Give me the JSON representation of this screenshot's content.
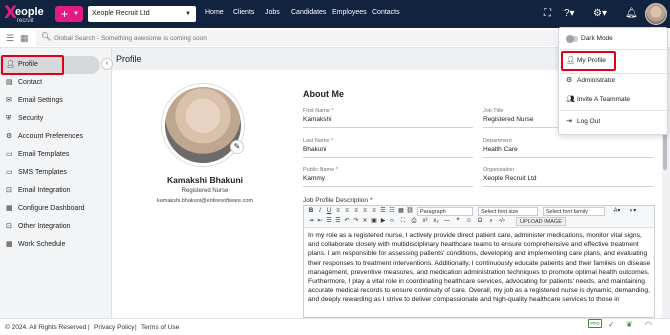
{
  "header": {
    "logo_main": "eople",
    "logo_sub": "recruit",
    "logo_x": "X",
    "company": "Xeople Recruit Ltd",
    "nav": [
      "Home",
      "Clients",
      "Jobs",
      "Candidates",
      "Employees",
      "Contacts"
    ],
    "icons": [
      "fullscreen-icon",
      "help-icon",
      "gear-icon",
      "bell-icon"
    ],
    "colors": {
      "navbar": "#12233f",
      "accent": "#e31b84"
    }
  },
  "search": {
    "placeholder": "Global Search - Something awesome is coming soon"
  },
  "sidebar": {
    "items": [
      {
        "label": "Profile",
        "icon": "user-icon"
      },
      {
        "label": "Contact",
        "icon": "address-card-icon"
      },
      {
        "label": "Email Settings",
        "icon": "mail-icon"
      },
      {
        "label": "Security",
        "icon": "shield-icon"
      },
      {
        "label": "Account Preferences",
        "icon": "account-gear-icon"
      },
      {
        "label": "Email Templates",
        "icon": "template-icon"
      },
      {
        "label": "SMS Templates",
        "icon": "sms-icon"
      },
      {
        "label": "Email Integration",
        "icon": "plug-icon"
      },
      {
        "label": "Configure Dashboard",
        "icon": "dashboard-icon"
      },
      {
        "label": "Other Integration",
        "icon": "plug-icon"
      },
      {
        "label": "Work Schedule",
        "icon": "calendar-icon"
      }
    ]
  },
  "main": {
    "title": "Profile",
    "profile": {
      "name": "Kamakshi Bhakuni",
      "role": "Registered Nurse",
      "email": "kamakshi.bhakuni@entiresoftware.com"
    },
    "about_title": "About Me",
    "fields": {
      "first_name": {
        "label": "First Name *",
        "value": "Kamakshi"
      },
      "job_title": {
        "label": "Job Title",
        "value": "Registered Nurse"
      },
      "last_name": {
        "label": "Last Name *",
        "value": "Bhakuni"
      },
      "department": {
        "label": "Department",
        "value": "Health Care"
      },
      "public_name": {
        "label": "Public Name *",
        "value": "Kammy"
      },
      "organisation": {
        "label": "Organisation",
        "value": "Xeople Recruit Ltd"
      }
    },
    "description_label": "Job Profile Description *",
    "editor": {
      "paragraph": "Paragraph",
      "font_size": "Select font size",
      "font_family": "Select font family",
      "upload": "UPLOAD IMAGE",
      "text": "In my role as a registered nurse, I actively provide direct patient care, administer medications, monitor vital signs, and collaborate closely with multidisciplinary healthcare teams to ensure comprehensive and effective treatment plans. I am responsible for assessing patients' conditions, developing and implementing care plans, and evaluating their responses to treatment interventions. Additionally, I continuously educate patients and their families on disease management, preventive measures, and medication administration techniques to promote optimal health outcomes. Furthermore, I play a vital role in coordinating healthcare services, advocating for patients' needs, and maintaining accurate medical records to ensure continuity of care. Overall, my job as a registered nurse is dynamic, demanding, and deeply rewarding as I strive to deliver compassionate and high-quality healthcare services to those in"
    }
  },
  "dropdown": {
    "dark_mode": "Dark Mode",
    "my_profile": "My Profile",
    "administrator": "Administrator",
    "invite": "Invite A Teammate",
    "logout": "Log Out"
  },
  "footer": {
    "copyright": "© 2024. All Rights Reserved",
    "privacy": "Privacy Policy",
    "terms": "Terms of Use",
    "sep": "|",
    "badge": "PPD"
  }
}
